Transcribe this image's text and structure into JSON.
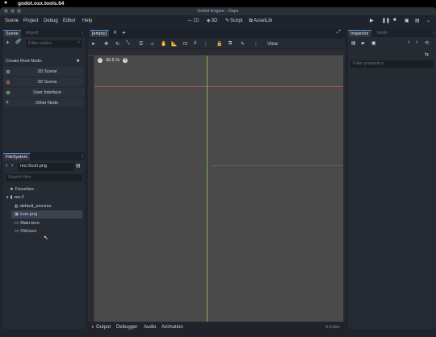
{
  "mac": {
    "app_name": "godot.osx.tools.64"
  },
  "window": {
    "title": "Godot Engine - Daps"
  },
  "menu": [
    "Scene",
    "Project",
    "Debug",
    "Editor",
    "Help"
  ],
  "workspaces": {
    "w2d": "2D",
    "w3d": "3D",
    "script": "Script",
    "assetlib": "AssetLib"
  },
  "scene_dock": {
    "tab_active": "Scene",
    "tab_inactive": "Import",
    "filter_placeholder": "Filter nodes",
    "create_root_label": "Create Root Node:",
    "buttons": [
      "2D Scene",
      "3D Scene",
      "User Interface",
      "Other Node"
    ]
  },
  "filesystem_dock": {
    "tab": "FileSystem",
    "path": "res://icon.png",
    "search_placeholder": "Search files",
    "favorites": "Favorites:",
    "root": "res://",
    "files": [
      "default_env.tres",
      "icon.png",
      "Main.tscn",
      "Old.tscn"
    ]
  },
  "editor_tab": {
    "name": "[empty]"
  },
  "canvas_toolbar": {
    "view": "View"
  },
  "viewport": {
    "zoom": "42.6 %"
  },
  "bottom_panel": {
    "items": [
      "Output",
      "Debugger",
      "Audio",
      "Animation"
    ],
    "version": "4.0.dev"
  },
  "inspector_dock": {
    "tab_active": "Inspector",
    "tab_inactive": "Node",
    "filter_placeholder": "Filter properties"
  },
  "colors": {
    "accent": "#5e8ed8",
    "red_axis": "#c24b4b",
    "green_axis": "#7fb04a",
    "viewport_bg": "#4a4a4a"
  }
}
